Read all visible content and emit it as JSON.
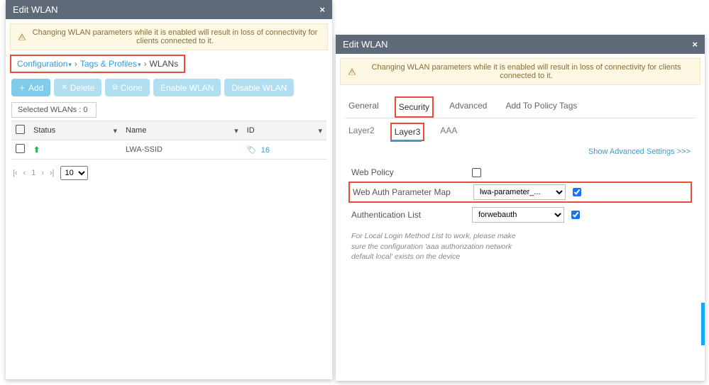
{
  "panel_left": {
    "title": "Edit WLAN",
    "banner": "Changing WLAN parameters while it is enabled will result in loss of connectivity for clients connected to it.",
    "breadcrumb": {
      "a": "Configuration",
      "b": "Tags & Profiles",
      "c": "WLANs"
    },
    "buttons": {
      "add": "Add",
      "delete": "Delete",
      "clone": "Clone",
      "enable": "Enable WLAN",
      "disable": "Disable WLAN"
    },
    "selected_label": "Selected WLANs : 0",
    "columns": {
      "status": "Status",
      "name": "Name",
      "id": "ID"
    },
    "row": {
      "name": "LWA-SSID",
      "id": "16"
    },
    "pager": {
      "page": "1",
      "size": "10"
    }
  },
  "panel_right": {
    "title": "Edit WLAN",
    "banner": "Changing WLAN parameters while it is enabled will result in loss of connectivity for clients connected to it.",
    "tabs": {
      "general": "General",
      "security": "Security",
      "advanced": "Advanced",
      "policy": "Add To Policy Tags"
    },
    "subtabs": {
      "l2": "Layer2",
      "l3": "Layer3",
      "aaa": "AAA"
    },
    "adv_link": "Show Advanced Settings >>>",
    "form": {
      "web_policy_label": "Web Policy",
      "map_label": "Web Auth Parameter Map",
      "map_value": "lwa-parameter_...",
      "auth_label": "Authentication List",
      "auth_value": "forwebauth"
    },
    "helper": "For Local Login Method List to work, please make sure the configuration 'aaa authorization network default local' exists on the device"
  }
}
